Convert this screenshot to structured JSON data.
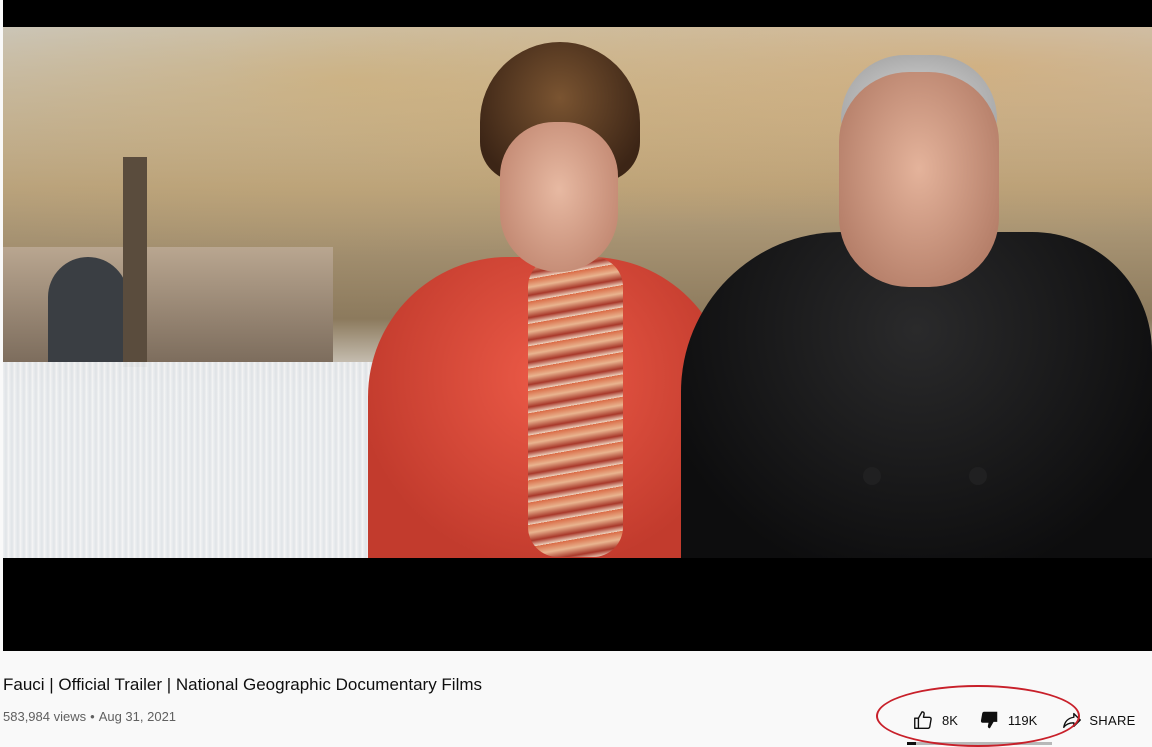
{
  "video": {
    "title": "Fauci | Official Trailer | National Geographic Documentary Films",
    "views": "583,984 views",
    "separator": "•",
    "date": "Aug 31, 2021"
  },
  "actions": {
    "like": {
      "icon": "thumb-up-icon",
      "count": "8K"
    },
    "dislike": {
      "icon": "thumb-down-icon",
      "count": "119K"
    },
    "share": {
      "icon": "share-icon",
      "label": "SHARE"
    }
  },
  "ratio": {
    "like_fraction": 0.063
  },
  "colors": {
    "annotation": "#c8202a",
    "text_primary": "#0f0f0f",
    "text_secondary": "#606060",
    "page_bg": "#f9f9f9"
  }
}
